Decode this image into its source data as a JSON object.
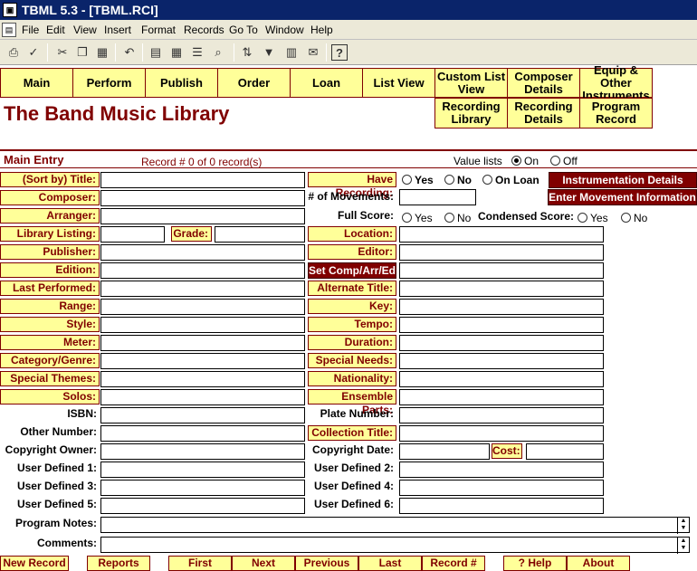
{
  "window": {
    "title": "TBML 5.3 - [TBML.RCI]",
    "app_icon": "tbml-app-icon"
  },
  "menu": [
    "File",
    "Edit",
    "View",
    "Insert",
    "Format",
    "Records",
    "Go To",
    "Window",
    "Help"
  ],
  "toolbar_icons": [
    "print-icon",
    "spellcheck-icon",
    "cut-icon",
    "copy-icon",
    "paste-icon",
    "undo-icon",
    "form-view-icon",
    "table-view-icon",
    "list-view-icon",
    "find-icon",
    "sort-icon",
    "filter-icon",
    "mail-icon",
    "help-icon"
  ],
  "nav": {
    "main": "Main",
    "perform": "Perform",
    "publish": "Publish",
    "order": "Order",
    "loan": "Loan",
    "list_view": "List View",
    "custom_list_view": "Custom List View",
    "composer_details": "Composer Details",
    "equip_other": "Equip & Other Instruments",
    "recording_library": "Recording Library",
    "recording_details": "Recording Details",
    "program_record": "Program Record"
  },
  "app_title": "The Band Music Library",
  "section": {
    "title": "Main Entry",
    "record_info": "Record # 0 of 0 record(s)"
  },
  "value_lists": {
    "label": "Value lists",
    "on": "On",
    "off": "Off",
    "selected": "On"
  },
  "fields": {
    "sort_title": "(Sort by) Title:",
    "composer": "Composer:",
    "arranger": "Arranger:",
    "library_listing": "Library Listing:",
    "grade": "Grade:",
    "publisher": "Publisher:",
    "edition": "Edition:",
    "last_performed": "Last Performed:",
    "range": "Range:",
    "style": "Style:",
    "meter": "Meter:",
    "category_genre": "Category/Genre:",
    "special_themes": "Special Themes:",
    "solos": "Solos:",
    "isbn": "ISBN:",
    "other_number": "Other Number:",
    "copyright_owner": "Copyright Owner:",
    "user1": "User Defined 1:",
    "user3": "User Defined 3:",
    "user5": "User Defined 5:",
    "program_notes": "Program Notes:",
    "comments": "Comments:",
    "have_recording": "Have Recording:",
    "yes": "Yes",
    "no": "No",
    "on_loan": "On Loan",
    "num_movements": "# of Movements:",
    "full_score": "Full Score:",
    "condensed_score": "Condensed Score:",
    "location": "Location:",
    "editor": "Editor:",
    "set_comp": "Set Comp/Arr/Ed",
    "alternate_title": "Alternate Title:",
    "key": "Key:",
    "tempo": "Tempo:",
    "duration": "Duration:",
    "special_needs": "Special Needs:",
    "nationality": "Nationality:",
    "ensemble_parts": "Ensemble Parts:",
    "plate_number": "Plate Number:",
    "collection_title": "Collection Title:",
    "copyright_date": "Copyright Date:",
    "cost": "Cost:",
    "user2": "User Defined 2:",
    "user4": "User Defined 4:",
    "user6": "User Defined 6:"
  },
  "actions": {
    "instrumentation": "Instrumentation Details",
    "movement_info": "Enter Movement Information"
  },
  "bottom": [
    "New Record",
    "Reports",
    "First",
    "Next",
    "Previous",
    "Last",
    "Record #",
    "? Help",
    "About"
  ],
  "colors": {
    "accent": "#800000",
    "button_bg": "#ffff99",
    "title_bar": "#0a246a"
  }
}
